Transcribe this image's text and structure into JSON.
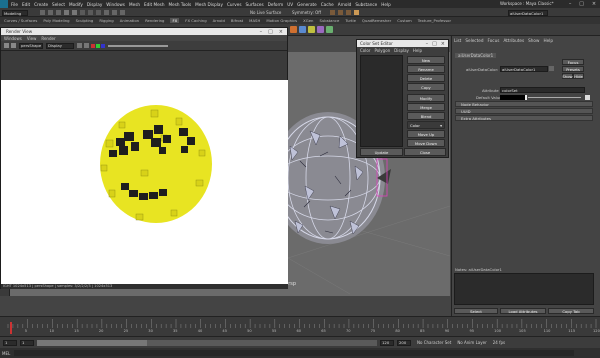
{
  "menubar": {
    "items": [
      "File",
      "Edit",
      "Create",
      "Select",
      "Modify",
      "Display",
      "Windows",
      "Mesh",
      "Edit Mesh",
      "Mesh Tools",
      "Mesh Display",
      "Curves",
      "Surfaces",
      "Deform",
      "UV",
      "Generate",
      "Cache",
      "Arnold",
      "Substance",
      "Help"
    ],
    "workspace": "Workspace : Maya Classic*"
  },
  "statusline": {
    "mode": "Modeling",
    "no_live_surface": "No Live Surface",
    "symmetry": "Symmetry: Off",
    "node_field": "aiUserDataColor1"
  },
  "shelf": {
    "tabs": [
      "Curves / Surfaces",
      "Poly Modeling",
      "Sculpting",
      "Rigging",
      "Animation",
      "Rendering",
      "FX",
      "FX Caching",
      "Arnold",
      "Bifrost",
      "MASH",
      "Motion Graphics",
      "XGen",
      "Substance",
      "Turtle",
      "QuadRemesher",
      "Custom",
      "Texture_Professor"
    ],
    "active_tab": "FX"
  },
  "render_view": {
    "title": "Render View",
    "menu": [
      "Windows",
      "View",
      "Render"
    ],
    "camera_field": "persShape",
    "display_field": "Display",
    "status": "Frame: 1 Memory: 263Mb Sampling: 3/2 camera: persShape Layer: defaultRenderLayer 1024x513",
    "status_short": "IGHT 1024x513 | persShape | samples: 3/2/2/2/3 | 1024x513"
  },
  "color_set_editor": {
    "title": "Color Set Editor",
    "menu": [
      "Color",
      "Polygon",
      "Display",
      "Help"
    ],
    "buttons": [
      "New",
      "Rename",
      "Delete",
      "Copy",
      "Modify",
      "Merge",
      "Blend",
      "Move Up",
      "Move Down"
    ],
    "dropdown": "Color",
    "update": "Update",
    "close": "Close"
  },
  "attribute_editor": {
    "tabs": [
      "List",
      "Selected",
      "Focus",
      "Attributes",
      "Show",
      "Help"
    ],
    "node_tab": "aiUserDataColor1",
    "node_label": "aiUserDataColor:",
    "node_value": "aiUserDataColor1",
    "focus": "Focus",
    "presets": "Presets",
    "show": "Show",
    "hide": "Hide",
    "attribute_label": "Attribute",
    "attribute_value": "colorSet",
    "default_label": "Default Value",
    "sections": [
      "Node Behavior",
      "UUID",
      "Extra Attributes"
    ],
    "notes_label": "Notes: aiUserDataColor1",
    "select": "Select",
    "load": "Load Attributes",
    "copy_tab": "Copy Tab"
  },
  "timeline": {
    "ticks": [
      "5",
      "10",
      "15",
      "20",
      "25",
      "30",
      "35",
      "40",
      "45",
      "50",
      "55",
      "60",
      "65",
      "70",
      "75",
      "80",
      "85",
      "90",
      "95",
      "100",
      "105",
      "110",
      "115",
      "120"
    ],
    "range_start": "1",
    "range_end": "120",
    "anim_end": "200",
    "fps": "24 fps",
    "char_set": "No Character Set",
    "anim_layer": "No Anim Layer"
  },
  "mel": "MEL"
}
